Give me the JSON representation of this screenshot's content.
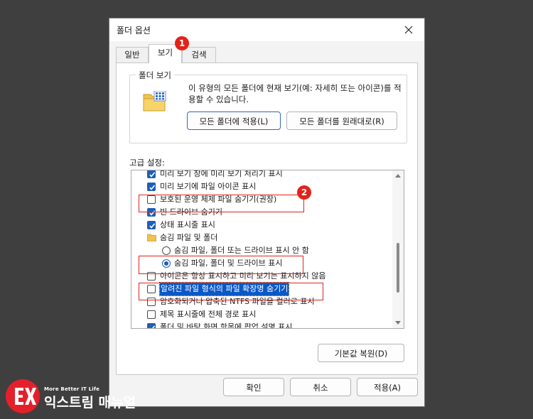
{
  "dialog": {
    "title": "폴더 옵션",
    "tabs": [
      {
        "label": "일반"
      },
      {
        "label": "보기"
      },
      {
        "label": "검색"
      }
    ]
  },
  "folder_views": {
    "group_title": "폴더 보기",
    "description": "이 유형의 모든 폴더에 현재 보기(예: 자세히 또는 아이콘)를 적용할 수 있습니다.",
    "apply_button": "모든 폴더에 적용(L)",
    "reset_button": "모든 폴더를 원래대로(R)"
  },
  "advanced": {
    "label": "고급 설정:",
    "items": [
      {
        "text": "미리 보기 창에 미리 보기 처리기 표시",
        "control": "checkbox",
        "checked": true
      },
      {
        "text": "미리 보기에 파일 아이콘 표시",
        "control": "checkbox",
        "checked": true
      },
      {
        "text": "보호된 운영 체제 파일 숨기기(권장)",
        "control": "checkbox",
        "checked": false
      },
      {
        "text": "빈 드라이브 숨기기",
        "control": "checkbox",
        "checked": true
      },
      {
        "text": "상태 표시줄 표시",
        "control": "checkbox",
        "checked": true
      },
      {
        "text": "숨김 파일 및 폴더",
        "control": "folder"
      },
      {
        "text": "숨김 파일, 폴더 또는 드라이브 표시 안 함",
        "control": "radio",
        "checked": false
      },
      {
        "text": "숨김 파일, 폴더 및 드라이브 표시",
        "control": "radio",
        "checked": true
      },
      {
        "text": "아이콘은 항상 표시하고 미리 보기는 표시하지 않음",
        "control": "checkbox",
        "checked": false
      },
      {
        "text": "알려진 파일 형식의 파일 확장명 숨기기",
        "control": "checkbox",
        "checked": false,
        "selected": true
      },
      {
        "text": "암호화되거나 압축된 NTFS 파일을 컬러로 표시",
        "control": "checkbox",
        "checked": false
      },
      {
        "text": "제목 표시줄에 전체 경로 표시",
        "control": "checkbox",
        "checked": false
      },
      {
        "text": "폴더 및 바탕 화면 항목에 팝업 설명 표시",
        "control": "checkbox",
        "checked": true
      }
    ],
    "restore_button": "기본값 복원(D)"
  },
  "footer": {
    "ok": "확인",
    "cancel": "취소",
    "apply": "적용(A)"
  },
  "annotations": [
    "1",
    "2"
  ],
  "logo": {
    "tagline": "More Better IT Life",
    "name": "익스트림 매뉴얼"
  },
  "colors": {
    "accent": "#1f5fb5",
    "highlight": "#e2231a",
    "selection": "#0a58c6"
  }
}
